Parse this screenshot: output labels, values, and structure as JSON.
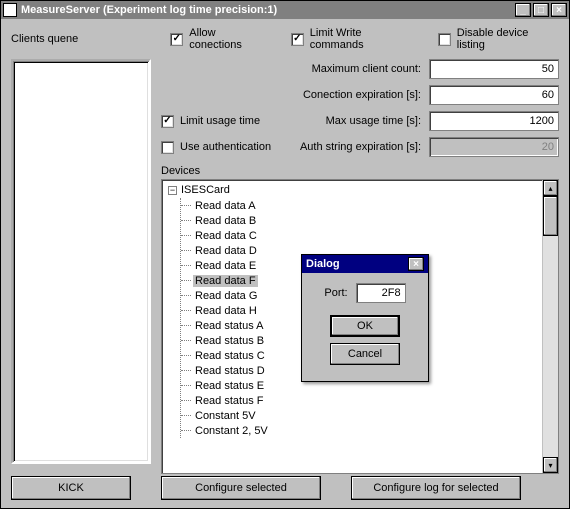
{
  "window": {
    "title": "MeasureServer (Experiment log time precision:1)"
  },
  "labels": {
    "clients_queue": "Clients quene",
    "devices": "Devices"
  },
  "checkboxes": {
    "allow_connections": {
      "label": "Allow conections",
      "checked": true
    },
    "limit_write": {
      "label": "Limit Write commands",
      "checked": true
    },
    "disable_listing": {
      "label": "Disable device listing",
      "checked": false
    },
    "limit_usage": {
      "label": "Limit usage time",
      "checked": true
    },
    "use_auth": {
      "label": "Use authentication",
      "checked": false
    }
  },
  "fields": {
    "max_clients": {
      "label": "Maximum client count:",
      "value": "50"
    },
    "conn_expiration": {
      "label": "Conection expiration [s]:",
      "value": "60"
    },
    "max_usage": {
      "label": "Max usage time [s]:",
      "value": "1200"
    },
    "auth_expiration": {
      "label": "Auth string expiration [s]:",
      "value": "20",
      "disabled": true
    }
  },
  "tree": {
    "root": "ISESCard",
    "items": [
      "Read data A",
      "Read data B",
      "Read data C",
      "Read data D",
      "Read data E",
      "Read data F",
      "Read data G",
      "Read data H",
      "Read status A",
      "Read status B",
      "Read status C",
      "Read status D",
      "Read status E",
      "Read status F",
      "Constant 5V",
      "Constant 2, 5V"
    ],
    "selected_index": 5
  },
  "buttons": {
    "kick": "KICK",
    "configure_selected": "Configure selected",
    "configure_log": "Configure log for selected"
  },
  "dialog": {
    "title": "Dialog",
    "port_label": "Port:",
    "port_value": "2F8",
    "ok": "OK",
    "cancel": "Cancel"
  }
}
